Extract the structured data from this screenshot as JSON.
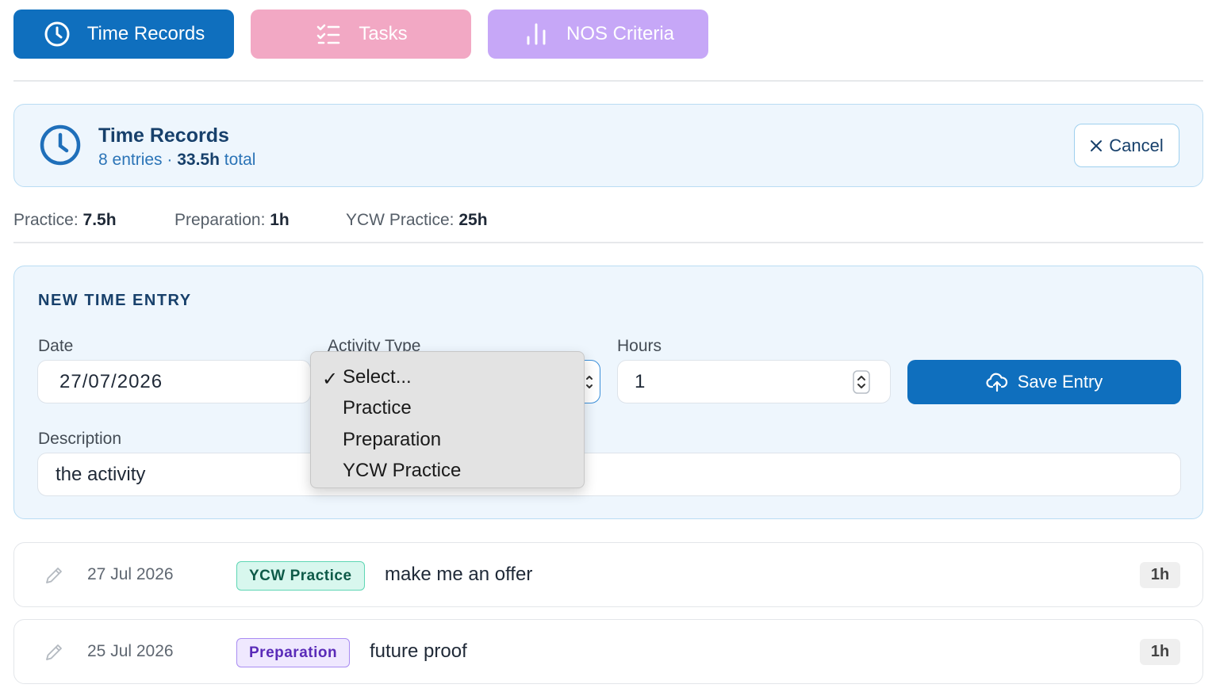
{
  "tabs": [
    {
      "label": "Time Records",
      "icon": "clock-icon",
      "color": "#0f6fbe"
    },
    {
      "label": "Tasks",
      "icon": "checklist-icon",
      "color": "#f2a8c4"
    },
    {
      "label": "NOS Criteria",
      "icon": "bar-chart-icon",
      "color": "#c6a7f7"
    }
  ],
  "header": {
    "title": "Time Records",
    "entries": "8 entries",
    "separator": " · ",
    "total": "33.5h",
    "total_suffix": " total",
    "cancel_label": "Cancel"
  },
  "stats": [
    {
      "label": "Practice: ",
      "value": "7.5h"
    },
    {
      "label": "Preparation: ",
      "value": "1h"
    },
    {
      "label": "YCW Practice: ",
      "value": "25h"
    }
  ],
  "form": {
    "heading": "NEW TIME ENTRY",
    "date_label": "Date",
    "date_value": "27/07/2026",
    "activity_label": "Activity Type",
    "hours_label": "Hours",
    "hours_value": "1",
    "save_label": "Save Entry",
    "description_label": "Description",
    "description_value": "the activity"
  },
  "dropdown": {
    "options": [
      "Select...",
      "Practice",
      "Preparation",
      "YCW Practice"
    ],
    "selected": "Select..."
  },
  "records": [
    {
      "date": "27 Jul 2026",
      "type": "YCW Practice",
      "description": "make me an offer",
      "hours": "1h"
    },
    {
      "date": "25 Jul 2026",
      "type": "Preparation",
      "description": "future proof",
      "hours": "1h"
    }
  ]
}
